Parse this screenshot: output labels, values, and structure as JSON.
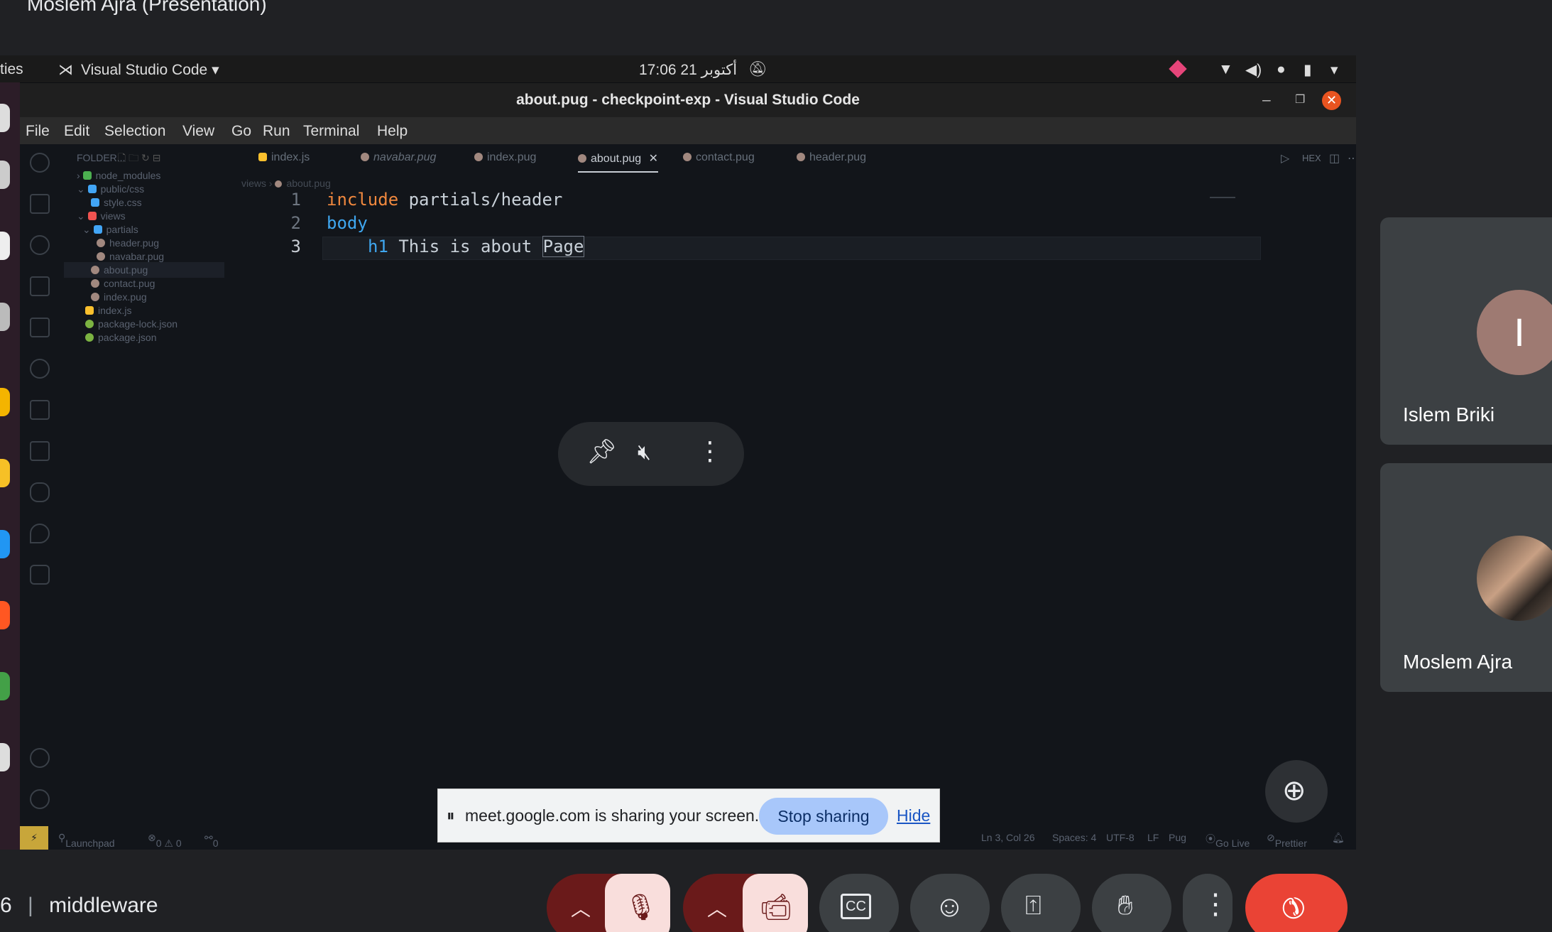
{
  "meet": {
    "presentation_title": "Moslem Ajra (Presentation)",
    "bottom_left_time": "6",
    "meeting_name": "middleware"
  },
  "ubuntu_bar": {
    "activities": "ties",
    "app_menu": "Visual Studio Code",
    "clock": "17:06 21 أكتوبر"
  },
  "vscode": {
    "window_title": "about.pug - checkpoint-exp - Visual Studio Code",
    "menu": [
      "File",
      "Edit",
      "Selection",
      "View",
      "Go",
      "Run",
      "Terminal",
      "Help"
    ],
    "explorer_header": "FOLDER...",
    "tree": [
      {
        "label": "node_modules",
        "icon_color": "#4caf50"
      },
      {
        "label": "public/css",
        "icon_color": "#42a5f5"
      },
      {
        "label": "style.css",
        "icon_color": "#42a5f5"
      },
      {
        "label": "views",
        "icon_color": "#ef5350"
      },
      {
        "label": "partials",
        "icon_color": "#42a5f5"
      },
      {
        "label": "header.pug",
        "icon_color": "#a1887f"
      },
      {
        "label": "navabar.pug",
        "icon_color": "#a1887f"
      },
      {
        "label": "about.pug",
        "icon_color": "#a1887f"
      },
      {
        "label": "contact.pug",
        "icon_color": "#a1887f"
      },
      {
        "label": "index.pug",
        "icon_color": "#a1887f"
      },
      {
        "label": "index.js",
        "icon_color": "#fbc02d"
      },
      {
        "label": "package-lock.json",
        "icon_color": "#7cb342"
      },
      {
        "label": "package.json",
        "icon_color": "#7cb342"
      }
    ],
    "tabs": [
      "index.js",
      "navabar.pug",
      "index.pug",
      "about.pug",
      "contact.pug",
      "header.pug"
    ],
    "active_tab": "about.pug",
    "tab_actions": {
      "hex": "HEX"
    },
    "breadcrumb": {
      "folder": "views",
      "file": "about.pug"
    },
    "code": {
      "line1_keyword": "include",
      "line1_rest": " partials/header",
      "line2_tag": "body",
      "line3_tag": "h1",
      "line3_text": " This is about ",
      "line3_selected": "Page"
    },
    "line_numbers": [
      "1",
      "2",
      "3"
    ],
    "status": {
      "launchpad": "Launchpad",
      "problems": "0 ⚠ 0",
      "ports": "0",
      "position": "Ln 3, Col 26",
      "spaces": "Spaces: 4",
      "encoding": "UTF-8",
      "eol": "LF",
      "language": "Pug",
      "golive": "Go Live",
      "prettier": "Prettier"
    }
  },
  "share_bar": {
    "message": "meet.google.com is sharing your screen.",
    "stop_label": "Stop sharing",
    "hide_label": "Hide"
  },
  "participants": [
    {
      "name": "Islem Briki",
      "initial": "I",
      "avatar_color": "#9e7a72"
    },
    {
      "name": "Moslem Ajra"
    }
  ],
  "colors": {
    "end_call": "#ea4335",
    "muted_bg": "#6a1a1a",
    "muted_fg": "#f9dedc",
    "control_bg": "#3c4043"
  }
}
